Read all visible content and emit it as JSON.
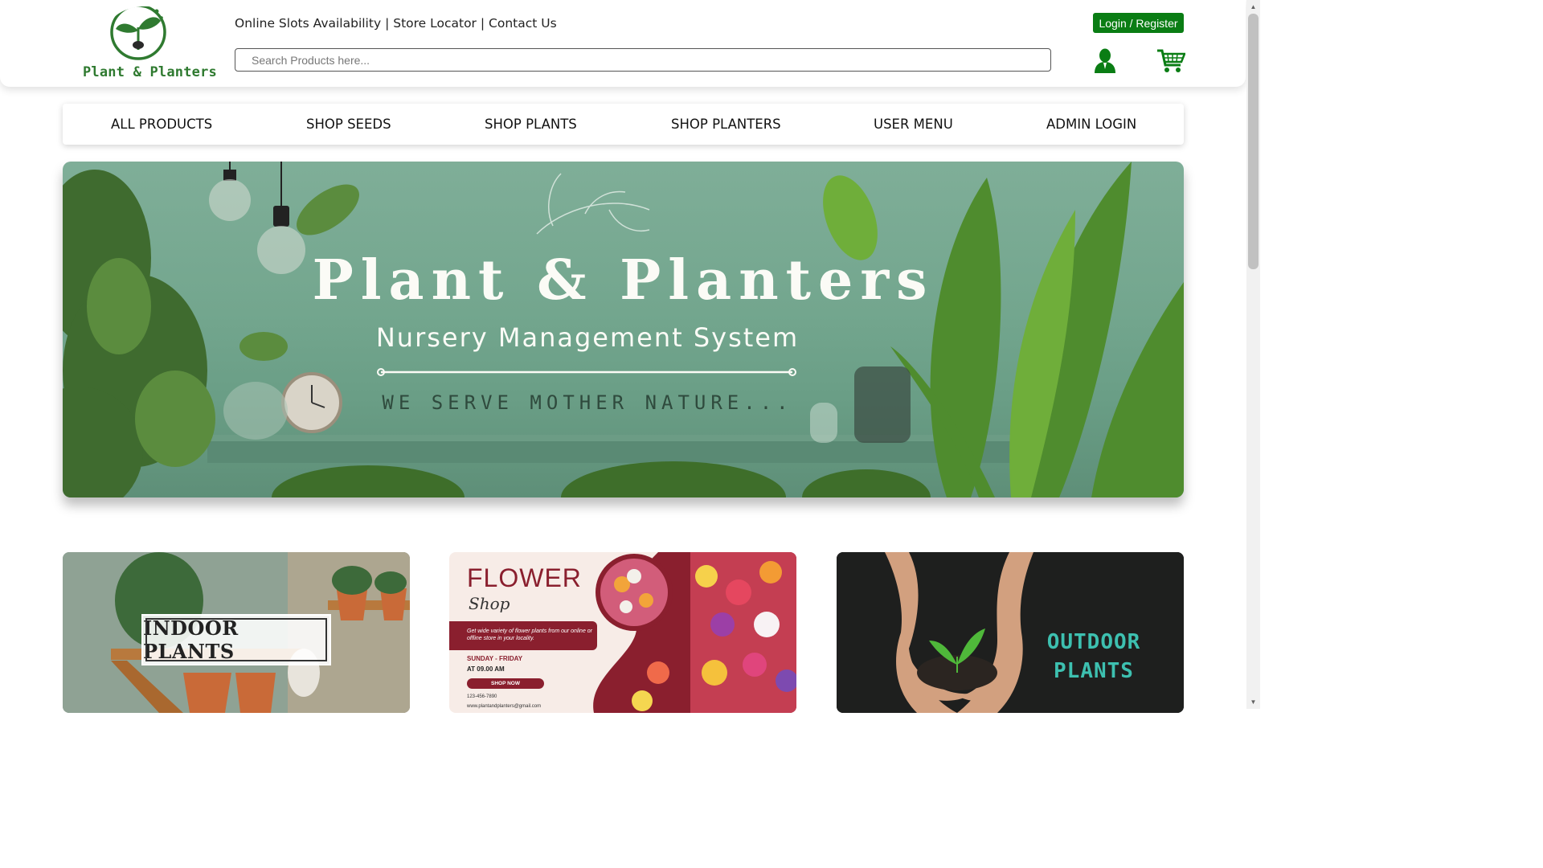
{
  "brand": {
    "name": "Plant & Planters",
    "color": "#2f7a30"
  },
  "top_links": {
    "slots": "Online Slots Availability",
    "separator": "|",
    "store": "Store Locator",
    "contact": "Contact Us"
  },
  "search": {
    "placeholder": "Search Products here..."
  },
  "header_actions": {
    "login_label": "Login / Register",
    "accent": "#0a7d14",
    "icons": [
      "user-icon",
      "cart-icon"
    ]
  },
  "nav": {
    "items": [
      "ALL PRODUCTS",
      "SHOP SEEDS",
      "SHOP PLANTS",
      "SHOP PLANTERS",
      "USER MENU",
      "ADMIN LOGIN"
    ]
  },
  "hero": {
    "title": "Plant & Planters",
    "subtitle": "Nursery Management System",
    "tagline": "WE SERVE MOTHER NATURE..."
  },
  "cards": {
    "indoor": {
      "label": "INDOOR PLANTS"
    },
    "flower": {
      "title": "FLOWER",
      "script": "Shop",
      "description": "Get wide variety of flower plants from our online or offline store in your locality.",
      "days": "SUNDAY - FRIDAY",
      "time": "AT 09.00 AM",
      "button": "SHOP NOW",
      "phone": "123-456-7890",
      "email": "www.plantandplanters@gmail.com",
      "accent": "#8a1f2e"
    },
    "outdoor": {
      "line1": "OUTDOOR",
      "line2": "PLANTS"
    }
  }
}
